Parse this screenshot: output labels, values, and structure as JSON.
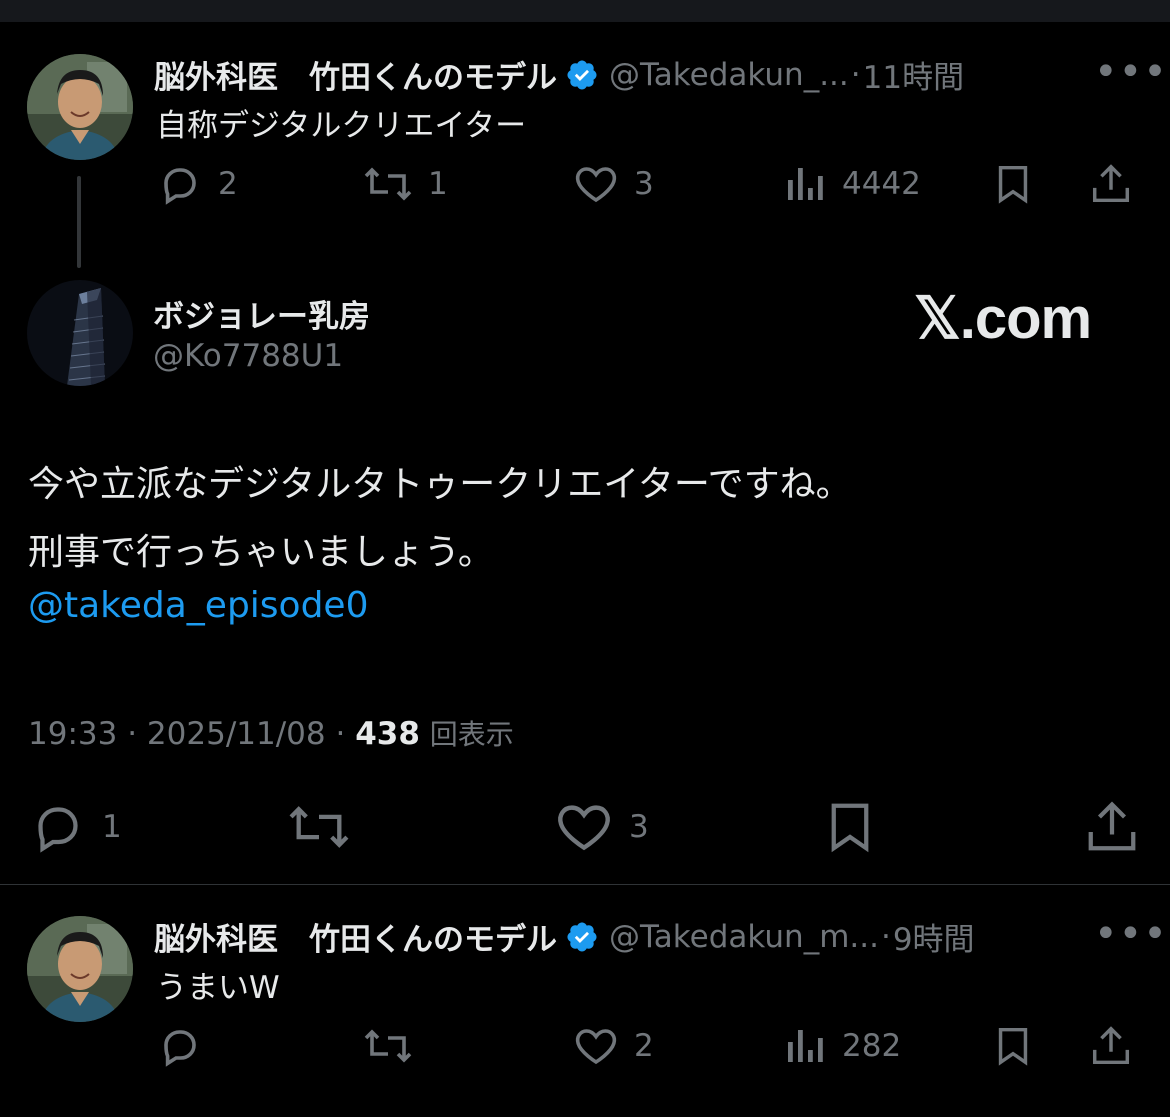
{
  "post1": {
    "display_name": "脳外科医　竹田くんのモデル",
    "handle": "@Takedakun_...",
    "dot": "·",
    "time_ago": "11時間",
    "more": "•••",
    "text": "自称デジタルクリエイター",
    "actions": {
      "replies": "2",
      "reposts": "1",
      "likes": "3",
      "views": "4442"
    }
  },
  "main": {
    "display_name": "ボジョレー乳房",
    "handle": "@Ko7788U1",
    "logo_text": "𝕏.com",
    "text_line1": "今や立派なデジタルタトゥークリエイターですね。",
    "text_line2": "刑事で行っちゃいましょう。",
    "mention": "@takeda_episode0",
    "time": "19:33",
    "sep": "·",
    "date": "2025/11/08",
    "view_count": "438",
    "view_label": "回表示",
    "actions": {
      "replies": "1",
      "likes": "3"
    }
  },
  "post2": {
    "display_name": "脳外科医　竹田くんのモデル",
    "handle": "@Takedakun_m...",
    "dot": "·",
    "time_ago": "9時間",
    "more": "•••",
    "text": "うまいW",
    "actions": {
      "likes": "2",
      "views": "282"
    }
  },
  "colors": {
    "accent": "#1d9bf0",
    "muted": "#71767b",
    "text": "#e7e9ea",
    "background": "#000000"
  }
}
